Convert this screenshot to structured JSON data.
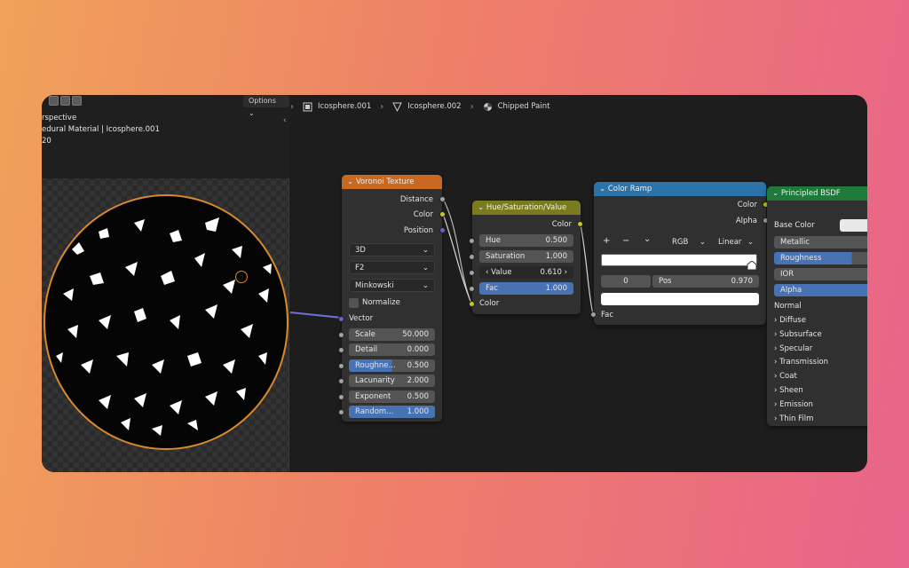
{
  "viewport": {
    "options_label": "Options",
    "line1": "rspective",
    "line2": "edural Material | Icosphere.001",
    "line3": "20"
  },
  "breadcrumb": {
    "item1": "Icosphere.001",
    "item2": "Icosphere.002",
    "item3": "Chipped Paint"
  },
  "voronoi": {
    "title": "Voronoi Texture",
    "out_distance": "Distance",
    "out_color": "Color",
    "out_position": "Position",
    "dim": "3D",
    "feature": "F2",
    "metric": "Minkowski",
    "normalize": "Normalize",
    "in_vector": "Vector",
    "fields": [
      {
        "label": "Scale",
        "value": "50.000"
      },
      {
        "label": "Detail",
        "value": "0.000"
      },
      {
        "label": "Roughne...",
        "value": "0.500"
      },
      {
        "label": "Lacunarity",
        "value": "2.000"
      },
      {
        "label": "Exponent",
        "value": "0.500"
      },
      {
        "label": "Random...",
        "value": "1.000"
      }
    ]
  },
  "hsv": {
    "title": "Hue/Saturation/Value",
    "out_color": "Color",
    "hue_label": "Hue",
    "hue_value": "0.500",
    "sat_label": "Saturation",
    "sat_value": "1.000",
    "val_label": "Value",
    "val_value": "0.610",
    "fac_label": "Fac",
    "fac_value": "1.000",
    "in_color": "Color"
  },
  "ramp": {
    "title": "Color Ramp",
    "out_color": "Color",
    "out_alpha": "Alpha",
    "add": "+",
    "remove": "−",
    "menu": "⌄",
    "mode": "RGB",
    "interp": "Linear",
    "stop_index": "0",
    "pos_label": "Pos",
    "pos_value": "0.970",
    "in_fac": "Fac"
  },
  "bsdf": {
    "title": "Principled BSDF",
    "base_color": "Base Color",
    "metallic": "Metallic",
    "roughness": "Roughness",
    "ior": "IOR",
    "alpha": "Alpha",
    "normal": "Normal",
    "panels": [
      "Diffuse",
      "Subsurface",
      "Specular",
      "Transmission",
      "Coat",
      "Sheen",
      "Emission",
      "Thin Film"
    ]
  },
  "colors": {
    "voronoi_header": "#c8691f",
    "hsv_header": "#7a7a1f",
    "ramp_header": "#2b73a8",
    "bsdf_header": "#1f7a3a",
    "field_blue": "#4772b3",
    "socket_yellow": "#c7c729",
    "socket_purple": "#6363c7",
    "socket_grey": "#a1a1a1"
  }
}
